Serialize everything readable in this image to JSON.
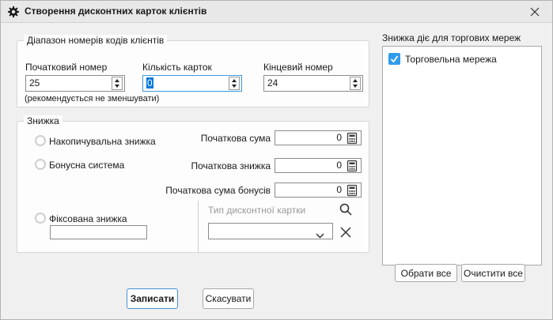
{
  "window": {
    "title": "Створення дисконтних карток клієнтів"
  },
  "range_group": {
    "legend": "Діапазон номерів кодів клієнтів",
    "fields": [
      {
        "label": "Початковий номер",
        "value": "25",
        "note": "(рекомендується не зменшувати)"
      },
      {
        "label": "Кількість карток",
        "value": "0"
      },
      {
        "label": "Кінцевий номер",
        "value": "24"
      }
    ]
  },
  "discount_group": {
    "legend": "Знижка",
    "radios": [
      {
        "label": "Накопичувальна знижка",
        "checked": false
      },
      {
        "label": "Бонусна система",
        "checked": false
      },
      {
        "label": "Фіксована знижка",
        "checked": false
      }
    ],
    "amount_fields": [
      {
        "label": "Початкова сума",
        "value": "0"
      },
      {
        "label": "Початкова знижка",
        "value": "0"
      },
      {
        "label": "Початкова сума бонусів",
        "value": "0"
      }
    ],
    "fixed_discount_value": "",
    "card_type": {
      "label": "Тип дисконтної картки",
      "value": ""
    }
  },
  "networks_panel": {
    "title": "Знижка діє для торгових мереж",
    "items": [
      {
        "label": "Торговельна мережа",
        "checked": true
      }
    ],
    "select_all_label": "Обрати все",
    "clear_all_label": "Очистити все"
  },
  "footer": {
    "save_label": "Записати",
    "cancel_label": "Скасувати"
  },
  "colors": {
    "accent_blue": "#0078d7",
    "focus_border": "#3b99e0",
    "checkbox_blue": "#2f9ceb",
    "window_bg": "#f0f0f0",
    "titlebar_bg": "#e8e8e8"
  },
  "icons": {
    "titlebar": "gear-icon",
    "close": "close-icon",
    "amount_fields": "calculator-icon",
    "card_type_search": "search-icon",
    "card_type_clear": "clear-x-icon",
    "combo": "chevron-down-icon"
  }
}
